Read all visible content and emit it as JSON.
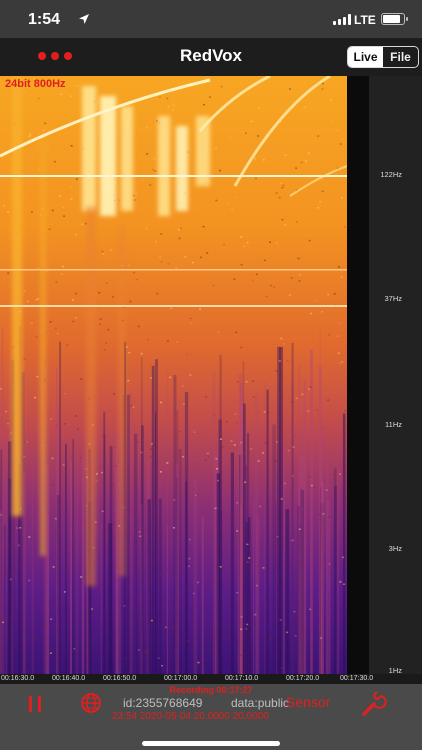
{
  "status_bar": {
    "time": "1:54",
    "network": "LTE",
    "icons": [
      "location-arrow-icon",
      "signal-icon",
      "battery-icon"
    ]
  },
  "nav": {
    "title": "RedVox",
    "menu_icon": "three-dots-icon",
    "segments": [
      {
        "label": "Live",
        "active": true
      },
      {
        "label": "File",
        "active": false
      }
    ]
  },
  "spectrogram": {
    "label": "24bit 800Hz",
    "frequency_ticks": [
      "122Hz",
      "37Hz",
      "11Hz",
      "3Hz",
      "1Hz"
    ],
    "time_ticks": [
      "00:16:30.0",
      "00:16:40.0",
      "00:16:50.0",
      "00:17:00.0",
      "00:17:10.0",
      "00:17:20.0",
      "00:17:30.0"
    ]
  },
  "toolbar": {
    "recording": "Recording 00:17:27",
    "device_id": "id:2355768649",
    "data_visibility": "data:public",
    "sensor_label": "Sensor",
    "sub_info": "23:54 2020-05-04 20.0000 20.0000",
    "icons": [
      "pause-icon",
      "globe-icon",
      "wrench-icon"
    ],
    "accent_color": "#e02020"
  }
}
